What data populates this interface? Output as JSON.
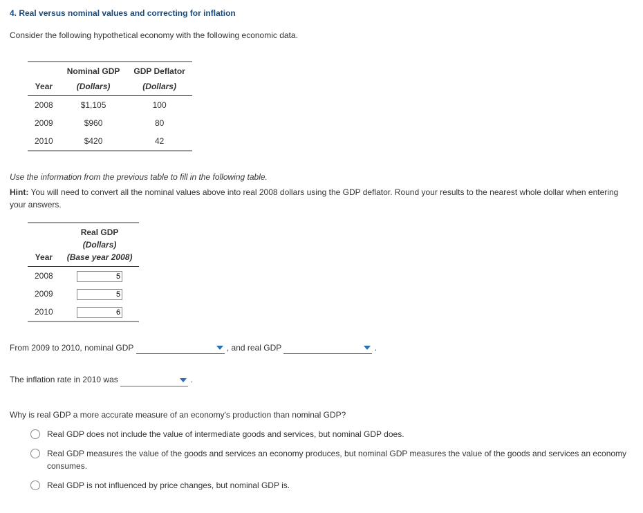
{
  "title": "4. Real versus nominal values and correcting for inflation",
  "intro": "Consider the following hypothetical economy with the following economic data.",
  "table1": {
    "headers": {
      "year": "Year",
      "nominal": "Nominal GDP",
      "nominal_sub": "(Dollars)",
      "deflator": "GDP Deflator",
      "deflator_sub": "(Dollars)"
    },
    "rows": [
      {
        "year": "2008",
        "nominal": "$1,105",
        "deflator": "100"
      },
      {
        "year": "2009",
        "nominal": "$960",
        "deflator": "80"
      },
      {
        "year": "2010",
        "nominal": "$420",
        "deflator": "42"
      }
    ]
  },
  "instruction_italic": "Use the information from the previous table to fill in the following table.",
  "hint_label": "Hint:",
  "hint_text": " You will need to convert all the nominal values above into real 2008 dollars using the GDP deflator. Round your results to the nearest whole dollar when entering your answers.",
  "table2": {
    "headers": {
      "year": "Year",
      "real": "Real GDP",
      "real_sub": "(Dollars)",
      "base": "(Base year 2008)"
    },
    "rows": [
      {
        "year": "2008",
        "value": "5"
      },
      {
        "year": "2009",
        "value": "5"
      },
      {
        "year": "2010",
        "value": "6"
      }
    ]
  },
  "sentence1": {
    "pre": "From 2009 to 2010, nominal GDP ",
    "mid": " , and real GDP ",
    "post": " ."
  },
  "sentence2": {
    "pre": "The inflation rate in 2010 was ",
    "post": " ."
  },
  "question": "Why is real GDP a more accurate measure of an economy's production than nominal GDP?",
  "options": [
    "Real GDP does not include the value of intermediate goods and services, but nominal GDP does.",
    "Real GDP measures the value of the goods and services an economy produces, but nominal GDP measures the value of the goods and services an economy consumes.",
    "Real GDP is not influenced by price changes, but nominal GDP is."
  ]
}
